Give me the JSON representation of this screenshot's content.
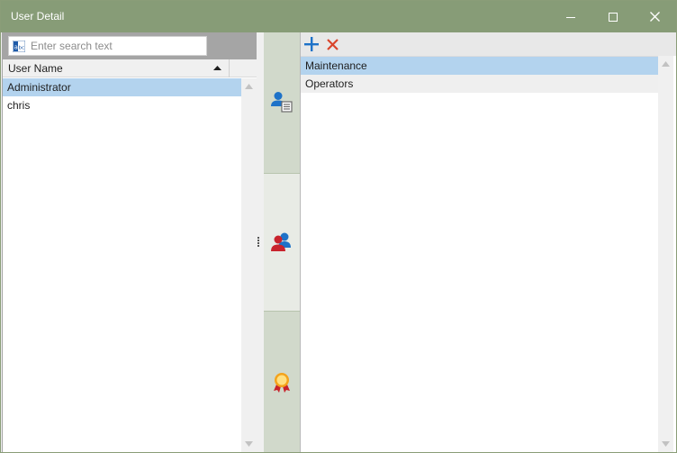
{
  "window": {
    "title": "User Detail"
  },
  "search": {
    "placeholder": "Enter search text",
    "value": ""
  },
  "users_grid": {
    "columns": [
      "User Name"
    ],
    "sort": "ascending",
    "rows": [
      "Administrator",
      "chris"
    ],
    "selected_index": 0
  },
  "nav": {
    "items": [
      {
        "icon": "user-card-icon"
      },
      {
        "icon": "user-groups-icon"
      },
      {
        "icon": "award-ribbon-icon"
      }
    ],
    "active_index": 1
  },
  "groups_list": {
    "items": [
      "Maintenance",
      "Operators"
    ],
    "selected_index": 0
  },
  "colors": {
    "titlebar": "#879c77",
    "selection": "#b3d3ee",
    "add_icon": "#1e72c8",
    "delete_icon": "#d9452b"
  }
}
